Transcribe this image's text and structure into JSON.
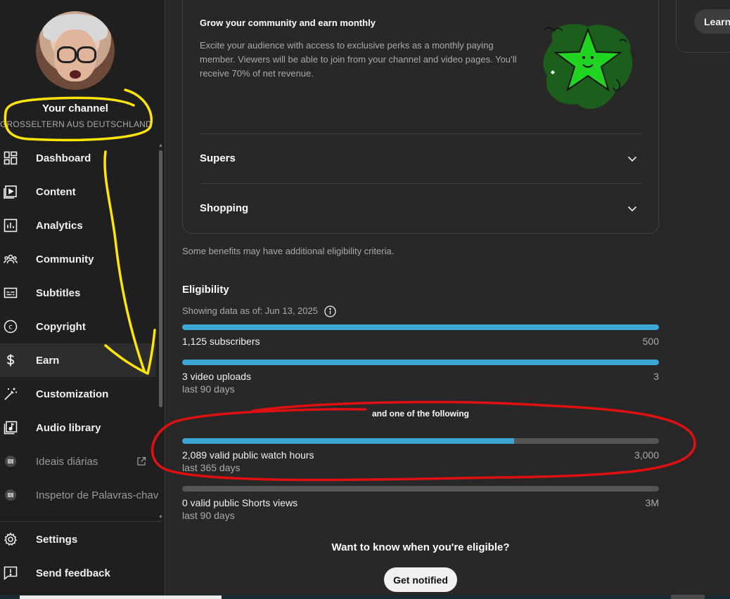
{
  "channel": {
    "title": "Your channel",
    "name": "GROSSELTERN AUS DEUTSCHLAND"
  },
  "sidebar": {
    "items": [
      {
        "label": "Dashboard",
        "icon": "dashboard-icon"
      },
      {
        "label": "Content",
        "icon": "content-icon"
      },
      {
        "label": "Analytics",
        "icon": "analytics-icon"
      },
      {
        "label": "Community",
        "icon": "community-icon"
      },
      {
        "label": "Subtitles",
        "icon": "subtitles-icon"
      },
      {
        "label": "Copyright",
        "icon": "copyright-icon"
      },
      {
        "label": "Earn",
        "icon": "dollar-icon",
        "active": true
      },
      {
        "label": "Customization",
        "icon": "magic-wand-icon"
      },
      {
        "label": "Audio library",
        "icon": "audio-library-icon"
      },
      {
        "label": "Ideais diárias",
        "icon": "extension-icon"
      },
      {
        "label": "Inspetor de Palavras-chav",
        "icon": "extension-icon"
      }
    ],
    "footer": [
      {
        "label": "Settings",
        "icon": "gear-icon"
      },
      {
        "label": "Send feedback",
        "icon": "feedback-icon"
      }
    ]
  },
  "main": {
    "memberships": {
      "title": "Grow your community and earn monthly",
      "description": "Excite your audience with access to exclusive perks as a monthly paying member. Viewers will be able to join from your channel and video pages. You’ll receive 70% of net revenue."
    },
    "accordions": [
      {
        "label": "Supers"
      },
      {
        "label": "Shopping"
      }
    ],
    "note": "Some benefits may have additional eligibility criteria.",
    "eligibility": {
      "title": "Eligibility",
      "showing": "Showing data as of: Jun 13, 2025",
      "requirements": [
        {
          "label": "1,125 subscribers",
          "target": "500",
          "sub": "",
          "progress": 1.0
        },
        {
          "label": "3 video uploads",
          "target": "3",
          "sub": "last 90 days",
          "progress": 1.0
        }
      ],
      "one_of": "and one of the following",
      "alternatives": [
        {
          "label": "2,089 valid public watch hours",
          "target": "3,000",
          "sub": "last 365 days",
          "progress": 0.6963
        },
        {
          "label": "0 valid public Shorts views",
          "target": "3M",
          "sub": "last 90 days",
          "progress": 0.0
        }
      ]
    },
    "want_title": "Want to know when you're eligible?",
    "notify_label": "Get notified",
    "learn_label": "Learn more"
  },
  "colors": {
    "accent": "#3ea6d4",
    "background": "#282828",
    "sidebar": "#1f1f1f",
    "annotation_yellow": "#ffe600",
    "annotation_red": "#e01010"
  }
}
